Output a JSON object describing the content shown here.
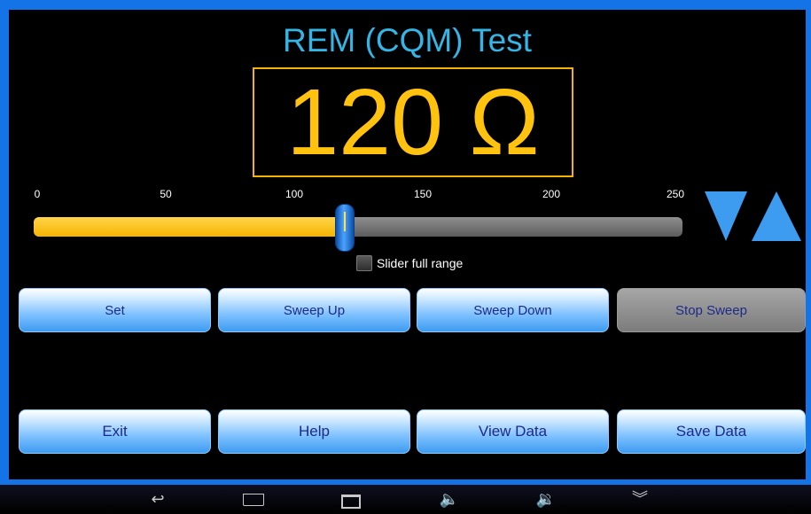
{
  "app": {
    "title": "REM (CQM) Test",
    "readout": "120 Ω"
  },
  "slider": {
    "ticks": [
      "0",
      "50",
      "100",
      "150",
      "200",
      "250"
    ],
    "min": 0,
    "max": 250,
    "value": 120,
    "full_range_label": "Slider full range",
    "full_range_checked": false
  },
  "buttons": {
    "set": "Set",
    "sweep_up": "Sweep Up",
    "sweep_down": "Sweep Down",
    "stop_sweep": "Stop Sweep",
    "exit": "Exit",
    "help": "Help",
    "view_data": "View Data",
    "save_data": "Save Data"
  },
  "nav": {
    "back": "↩",
    "volume_down": "🔈",
    "volume_up": "🔉",
    "menu": "︾"
  },
  "colors": {
    "accent": "#33b5e5",
    "readout": "#ffc20e",
    "frame": "#1473e6"
  }
}
